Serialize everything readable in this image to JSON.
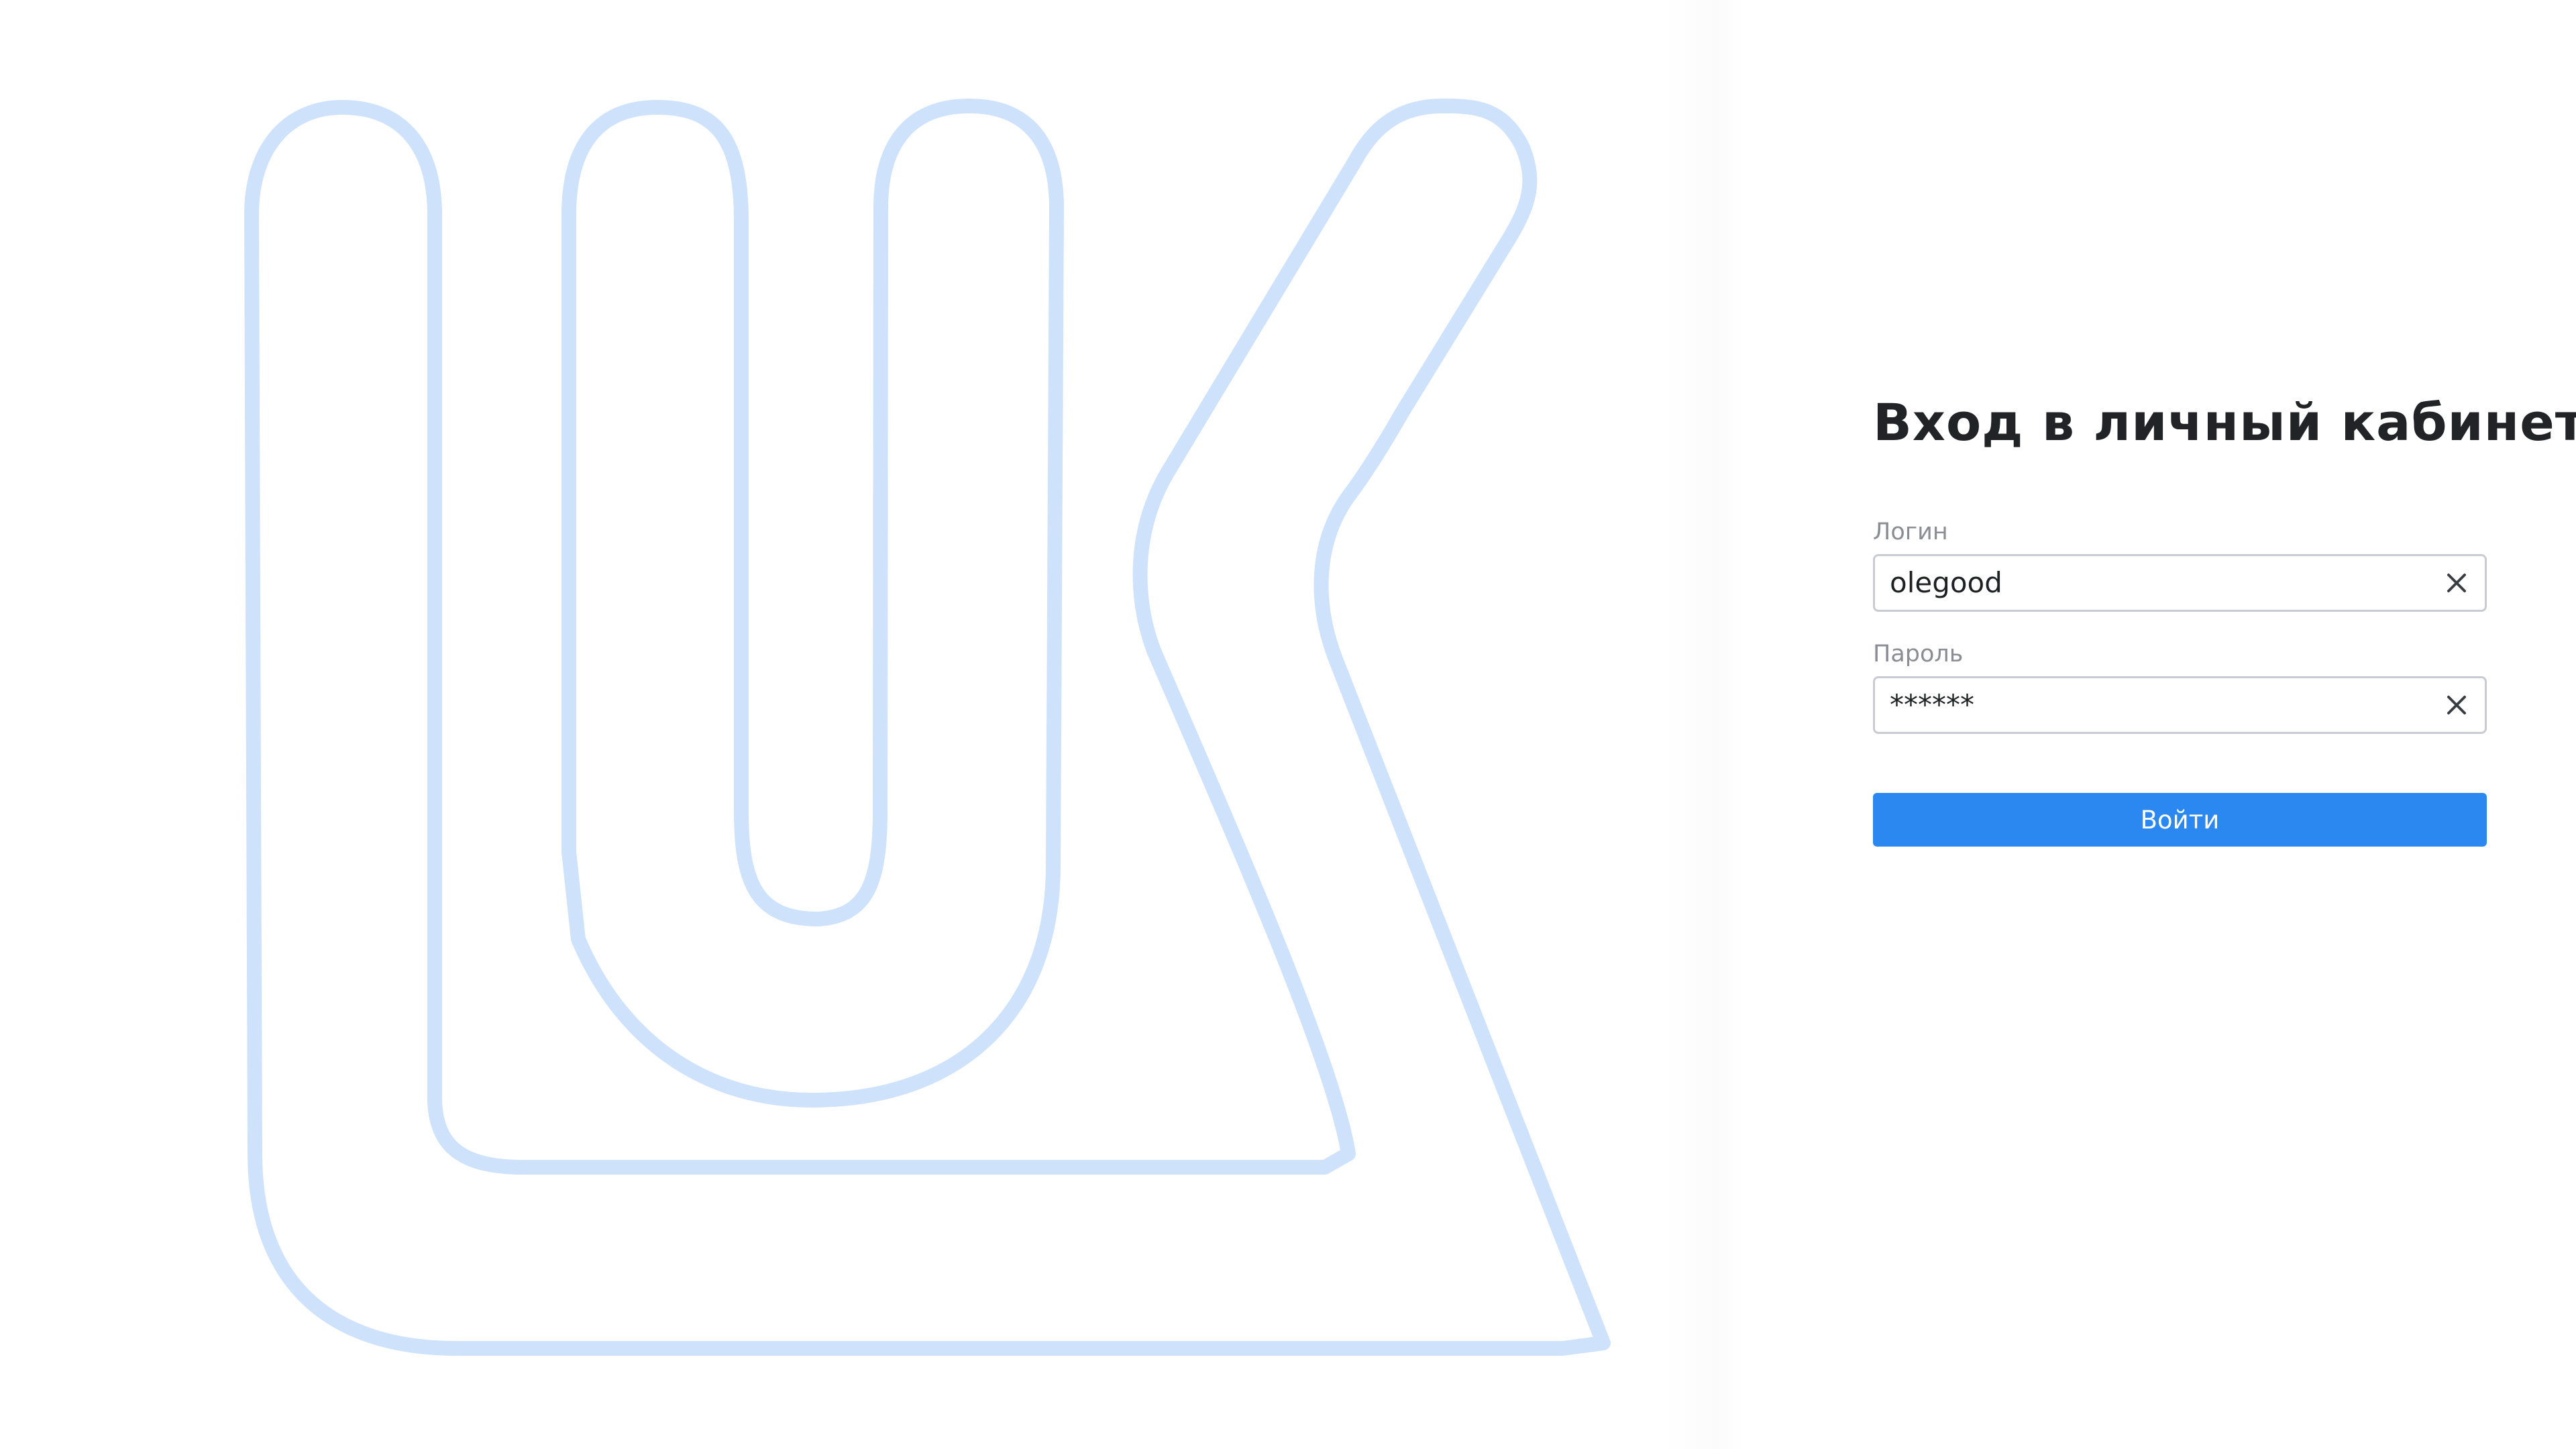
{
  "brand": {
    "logo_icon": "lukoil-outline-logo-icon",
    "logo_color": "#cfe2fb"
  },
  "login_form": {
    "title": "Вход в личный кабинет",
    "login_label": "Логин",
    "login_value": "olegood",
    "password_label": "Пароль",
    "password_value": "******",
    "clear_icon": "close-icon",
    "submit_label": "Войти",
    "accent_color": "#2b88f0"
  }
}
